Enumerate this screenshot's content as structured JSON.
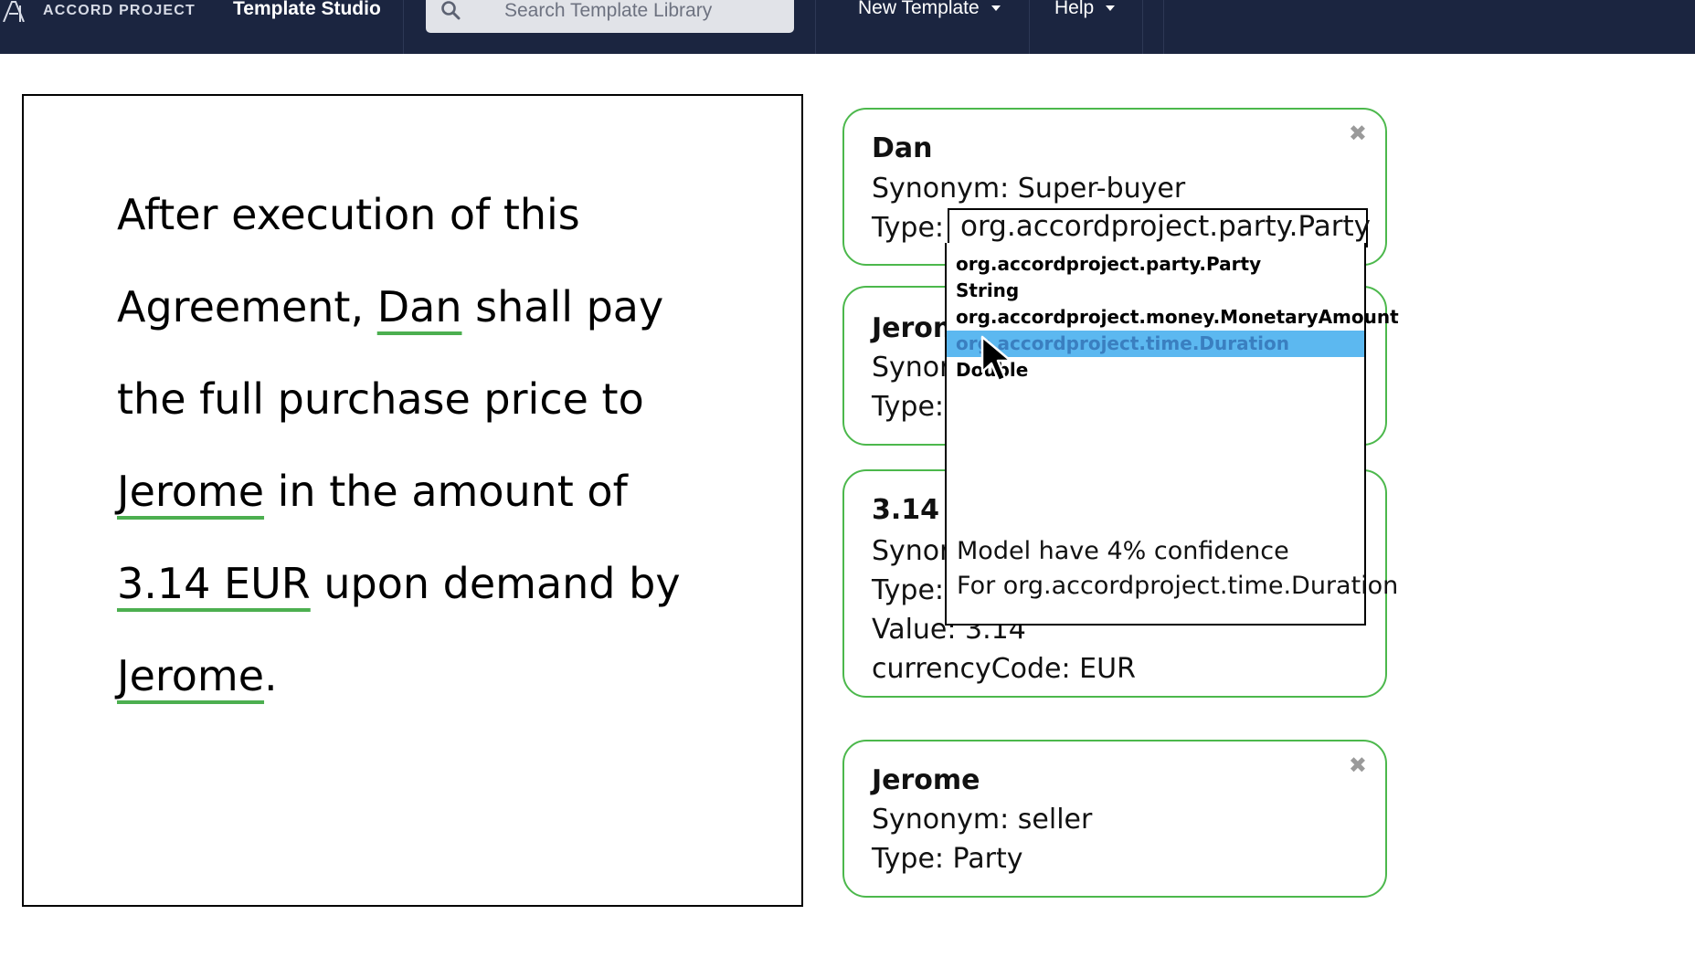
{
  "nav": {
    "brand": "ACCORD PROJECT",
    "app_title": "Template Studio",
    "search_placeholder": "Search Template Library",
    "menu_new": "New Template",
    "menu_help": "Help"
  },
  "contract": {
    "line1": "After execution of this",
    "line2_pre": "Agreement, ",
    "line2_ent": "Dan",
    "line2_post": " shall pay",
    "line3": "the full purchase price to",
    "line4_ent": "Jerome",
    "line4_post": " in the amount of",
    "line5_ent": "3.14 EUR",
    "line5_post": " upon demand by",
    "line6_ent": "Jerome",
    "line6_post": "."
  },
  "cards": {
    "dan": {
      "name": "Dan",
      "synonym": "Synonym: Super-buyer",
      "type_label": "Type:",
      "type_value": "org.accordproject.party.Party"
    },
    "jerome1": {
      "name": "Jerom",
      "synonym": "Synor",
      "type_label": "Type:"
    },
    "money": {
      "name": "3.14 E",
      "synonym": "Synor",
      "type_label": "Type:",
      "value": "Value: 3.14",
      "currency": "currencyCode: EUR"
    },
    "jerome2": {
      "name": "Jerome",
      "synonym": "Synonym: seller",
      "type": "Type: Party"
    }
  },
  "dropdown": {
    "options": [
      "org.accordproject.party.Party",
      "String",
      "org.accordproject.money.MonetaryAmount",
      "org.accordproject.time.Duration",
      "Double"
    ],
    "highlighted": "org.accordproject.time.Duration",
    "confidence": "Model have 4% confidence",
    "confidence_for": "For org.accordproject.time.Duration"
  },
  "colors": {
    "nav_bg": "#1b2540",
    "entity_underline": "#4caf50",
    "card_border": "#4cb84c",
    "highlight": "#5cb8f0"
  },
  "icons": [
    "accord-logo-icon",
    "search-icon",
    "chevron-down-icon",
    "close-icon",
    "mouse-cursor-icon"
  ]
}
